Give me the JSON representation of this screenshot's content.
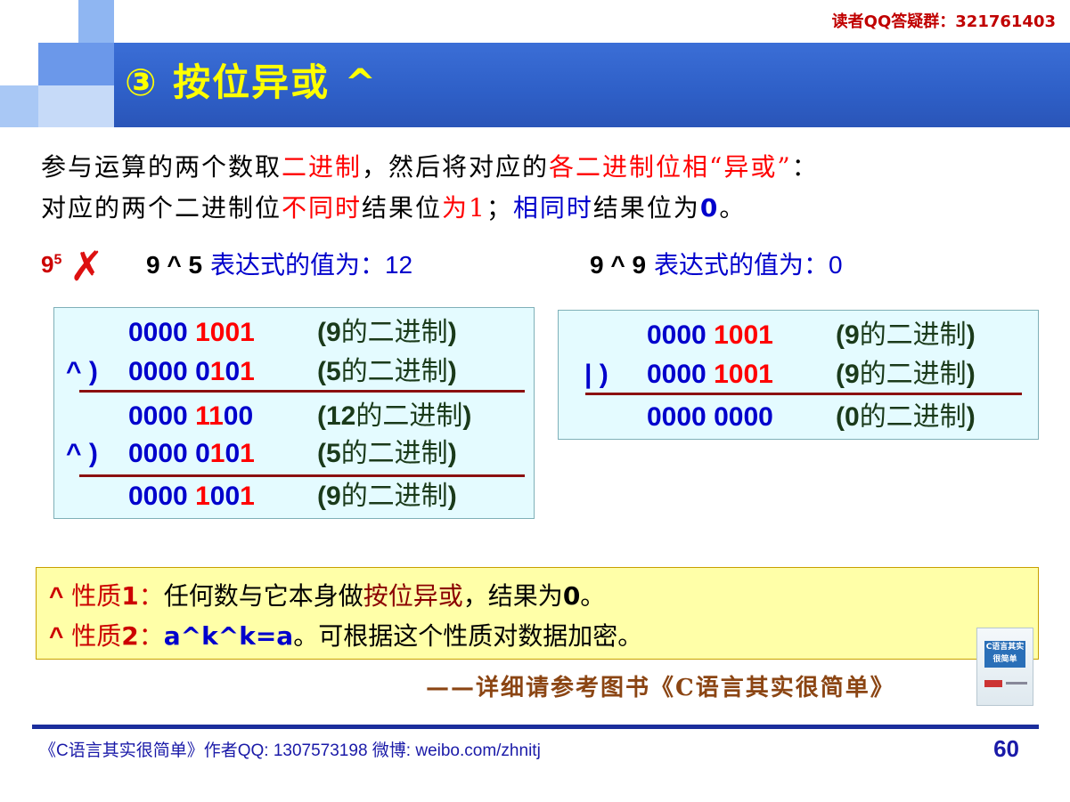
{
  "header": {
    "qq_group": "读者QQ答疑群：321761403",
    "title": "③ 按位异或 ^"
  },
  "intro": {
    "line1_a": "参与运算的两个数取",
    "line1_b": "二进制",
    "line1_c": "，然后将对应的",
    "line1_d": "各二进制位相“异或”",
    "line1_e": "：",
    "line2_a": "对应的两个二进制位",
    "line2_b": "不同时",
    "line2_c": "结果位",
    "line2_d": "为1",
    "line2_e": "；",
    "line2_f": "相同时",
    "line2_g": "结果位为",
    "line2_h": "0",
    "line2_i": "。"
  },
  "mark": {
    "label_base": "9",
    "label_sup": "5",
    "cross": "✗"
  },
  "expr1": {
    "expression": "9 ^ 5",
    "label": "表达式的值为：",
    "value": "12"
  },
  "expr2": {
    "expression": "9 ^ 9",
    "label": "表达式的值为：",
    "value": "0"
  },
  "calc1": {
    "rows": [
      {
        "op": "",
        "b1": "0000 ",
        "b2": "1",
        "b3": "0",
        "b4": "0",
        "b5": "1",
        "n1": "(9",
        "n2": "的二进制",
        "n3": ")"
      },
      {
        "op": "^ )",
        "b1": "0000 0",
        "b2": "1",
        "b3": "0",
        "b4": "1",
        "b5": "",
        "n1": "(5",
        "n2": "的二进制",
        "n3": ")"
      },
      {
        "op": "",
        "b1": "0000 ",
        "b2": "1",
        "b3": "1",
        "b4": "00",
        "b5": "",
        "n1": "(12",
        "n2": "的二进制",
        "n3": ")"
      },
      {
        "op": "^ )",
        "b1": "0000 0",
        "b2": "1",
        "b3": "0",
        "b4": "1",
        "b5": "",
        "n1": "(5",
        "n2": "的二进制",
        "n3": ")"
      },
      {
        "op": "",
        "b1": "0000 ",
        "b2": "1",
        "b3": "00",
        "b4": "1",
        "b5": "",
        "n1": "(9",
        "n2": "的二进制",
        "n3": ")"
      }
    ]
  },
  "calc2": {
    "rows": [
      {
        "op": "",
        "b1": "0000 ",
        "b2": "1",
        "b3": "00",
        "b4": "1",
        "n1": "(9",
        "n2": "的二进制",
        "n3": ")"
      },
      {
        "op": "| )",
        "b1": "0000 ",
        "b2": "1",
        "b3": "00",
        "b4": "1",
        "n1": "(9",
        "n2": "的二进制",
        "n3": ")"
      },
      {
        "op": "",
        "b1": "0000 0000",
        "b2": "",
        "b3": "",
        "b4": "",
        "n1": "(0",
        "n2": "的二进制",
        "n3": ")"
      }
    ]
  },
  "properties": [
    {
      "caret": "^",
      "tag": " 性质",
      "num": "1",
      "colon": "：",
      "text_a": "任何数与它本身做",
      "text_b": "按位异或",
      "text_c": "，结果为",
      "text_d": "0",
      "text_e": "。"
    },
    {
      "caret": "^",
      "tag": " 性质",
      "num": "2",
      "colon": "：",
      "text_a": "",
      "code": "a^k^k=a",
      "text_c": "。可根据这个性质对数据加密。"
    }
  ],
  "reference": "——详细请参考图书《C语言其实很简单》",
  "book_thumb": {
    "title_line1": "C语言其实",
    "title_line2": "很简单"
  },
  "footer": {
    "text": "《C语言其实很简单》作者QQ: 1307573198    微博: weibo.com/zhnitj",
    "page": "60"
  },
  "colors": {
    "title_bar": "#2e5fc7",
    "title_text": "#ffff00",
    "highlight_red": "#ff0000",
    "highlight_blue": "#0000cc",
    "calc_box_bg": "#e4fbff",
    "props_bg": "#ffffa8",
    "footer_rule": "#1b2e9c"
  }
}
